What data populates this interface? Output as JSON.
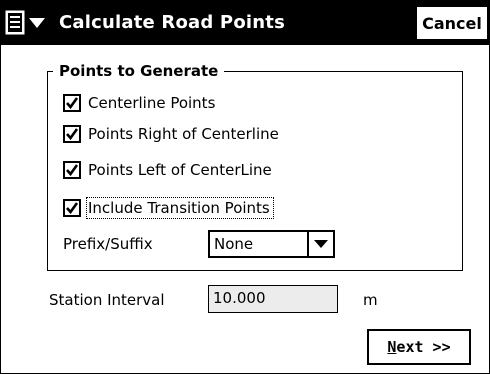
{
  "window": {
    "title": "Calculate Road Points",
    "cancel_label": "Cancel",
    "menu_icon": "menu-list-icon"
  },
  "group": {
    "legend": "Points to Generate",
    "checkboxes": [
      {
        "label": "Centerline Points",
        "checked": true
      },
      {
        "label": "Points Right of Centerline",
        "checked": true
      },
      {
        "label": "Points Left of CenterLine",
        "checked": true
      },
      {
        "label": "Include Transition Points",
        "checked": true
      }
    ],
    "prefix_label": "Prefix/Suffix",
    "prefix_value": "None"
  },
  "interval": {
    "label": "Station Interval",
    "value": "10.000",
    "unit": "m"
  },
  "next": {
    "mnemonic": "N",
    "rest": "ext >>"
  }
}
